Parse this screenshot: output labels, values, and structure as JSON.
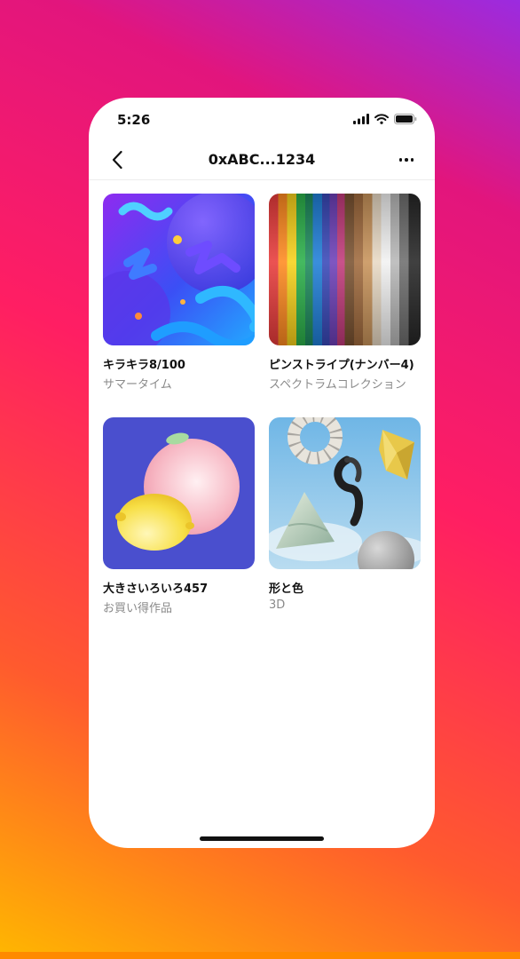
{
  "status_bar": {
    "time": "5:26"
  },
  "nav": {
    "title": "0xABC...1234"
  },
  "items": [
    {
      "title": "キラキラ8/100",
      "subtitle": "サマータイム",
      "art": "neon-squiggles"
    },
    {
      "title": "ピンストライプ(ナンバー4)",
      "subtitle": "スペクトラムコレクション",
      "art": "rainbow-stripes"
    },
    {
      "title": "大きさいろいろ457",
      "subtitle": "お買い得作品",
      "art": "peach-and-lemon"
    },
    {
      "title": "形と色",
      "subtitle": "3D",
      "art": "3d-shapes"
    }
  ],
  "colors": {
    "background_top": "#9b2be0",
    "background_mid": "#ff1e63",
    "background_bottom": "#ffb700",
    "card_surface": "#ffffff"
  }
}
